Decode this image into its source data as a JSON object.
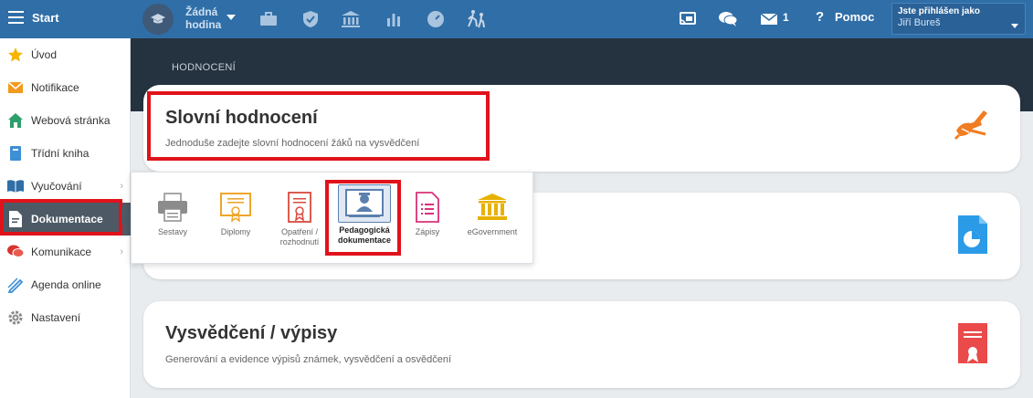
{
  "topbar": {
    "start_label": "Start",
    "hour_label": "Žádná hodina",
    "messages_count": "1",
    "help_label": "Pomoc",
    "user_prefix": "Jste přihlášen jako",
    "user_name": "Jiří Bureš",
    "icons": [
      "menu-icon",
      "graduation-cap-icon",
      "briefcase-icon",
      "shield-icon",
      "bank-icon",
      "bar-chart-icon",
      "speedometer-icon",
      "walking-people-icon",
      "cast-icon",
      "chat-icon",
      "envelope-icon",
      "help-icon"
    ]
  },
  "sidebar": {
    "items": [
      {
        "label": "Úvod",
        "icon": "star-icon",
        "color": "#f5b400"
      },
      {
        "label": "Notifikace",
        "icon": "envelope-icon",
        "color": "#f29a1d"
      },
      {
        "label": "Webová stránka",
        "icon": "house-icon",
        "color": "#2e9e6b"
      },
      {
        "label": "Třídní kniha",
        "icon": "book-icon",
        "color": "#3d8fd6"
      },
      {
        "label": "Vyučování",
        "icon": "open-book-icon",
        "color": "#2f6ea7"
      },
      {
        "label": "Dokumentace",
        "icon": "document-icon",
        "color": "#ffffff"
      },
      {
        "label": "Komunikace",
        "icon": "chat-bubbles-icon",
        "color": "#d9342b"
      },
      {
        "label": "Agenda online",
        "icon": "pen-icon",
        "color": "#3d8fd6"
      },
      {
        "label": "Nastavení",
        "icon": "gear-icon",
        "color": "#8a8a8a"
      }
    ]
  },
  "content": {
    "breadcrumb": "HODNOCENÍ",
    "cards": [
      {
        "title": "Slovní hodnocení",
        "description": "Jednoduše zadejte slovní hodnocení žáků na vysvědčení",
        "icon": "writing-hand-icon"
      },
      {
        "title": "",
        "description": "",
        "icon": "pie-document-icon"
      },
      {
        "title": "Vysvědčení / výpisy",
        "description": "Generování a evidence výpisů známek, vysvědčení a osvědčení",
        "icon": "certificate-icon"
      }
    ]
  },
  "popover": {
    "items": [
      {
        "label": "Sestavy",
        "icon": "printer-icon"
      },
      {
        "label": "Diplomy",
        "icon": "diploma-icon"
      },
      {
        "label": "Opatření / rozhodnutí",
        "icon": "decision-document-icon"
      },
      {
        "label": "Pedagogická dokumentace",
        "icon": "pedagogical-doc-icon",
        "selected": true
      },
      {
        "label": "Zápisy",
        "icon": "list-document-icon"
      },
      {
        "label": "eGovernment",
        "icon": "government-building-icon"
      }
    ]
  },
  "colors": {
    "topbar": "#2f6ea7",
    "sidebar_active": "#4d5a66",
    "dark_band": "#253240",
    "highlight": "#e0121b"
  }
}
